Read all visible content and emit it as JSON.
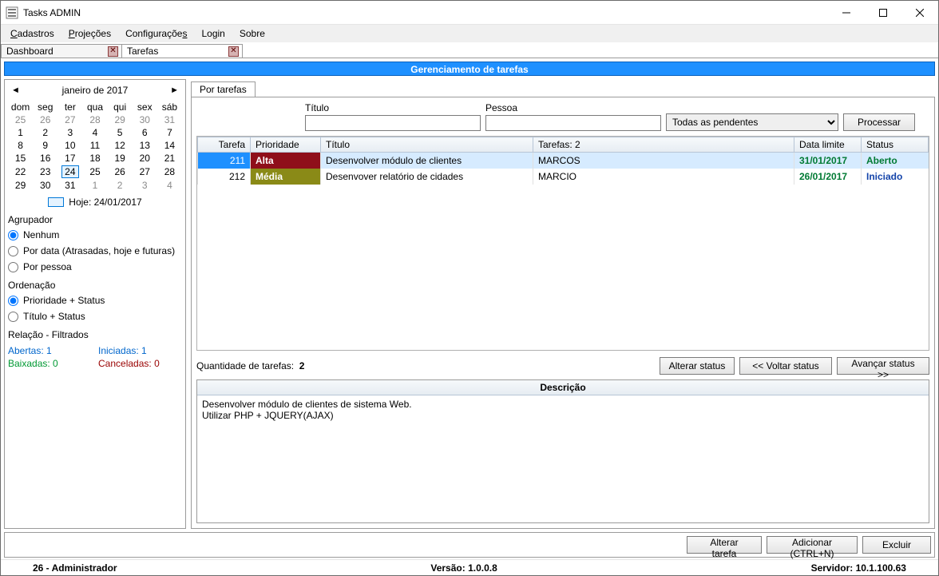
{
  "window": {
    "title": "Tasks ADMIN"
  },
  "menu": {
    "cadastros": "Cadastros",
    "projecoes": "Projeções",
    "configuracoes": "Configurações",
    "login": "Login",
    "sobre": "Sobre"
  },
  "tabs": {
    "dashboard": "Dashboard",
    "tarefas": "Tarefas"
  },
  "banner": "Gerenciamento de tarefas",
  "calendar": {
    "month": "janeiro de 2017",
    "dow": [
      "dom",
      "seg",
      "ter",
      "qua",
      "qui",
      "sex",
      "sáb"
    ],
    "weeks": [
      [
        {
          "d": "25",
          "g": true
        },
        {
          "d": "26",
          "g": true
        },
        {
          "d": "27",
          "g": true
        },
        {
          "d": "28",
          "g": true
        },
        {
          "d": "29",
          "g": true
        },
        {
          "d": "30",
          "g": true
        },
        {
          "d": "31",
          "g": true
        }
      ],
      [
        {
          "d": "1"
        },
        {
          "d": "2"
        },
        {
          "d": "3"
        },
        {
          "d": "4"
        },
        {
          "d": "5"
        },
        {
          "d": "6"
        },
        {
          "d": "7"
        }
      ],
      [
        {
          "d": "8"
        },
        {
          "d": "9"
        },
        {
          "d": "10"
        },
        {
          "d": "11"
        },
        {
          "d": "12"
        },
        {
          "d": "13"
        },
        {
          "d": "14"
        }
      ],
      [
        {
          "d": "15"
        },
        {
          "d": "16"
        },
        {
          "d": "17"
        },
        {
          "d": "18"
        },
        {
          "d": "19"
        },
        {
          "d": "20"
        },
        {
          "d": "21"
        }
      ],
      [
        {
          "d": "22"
        },
        {
          "d": "23"
        },
        {
          "d": "24",
          "t": true
        },
        {
          "d": "25"
        },
        {
          "d": "26"
        },
        {
          "d": "27"
        },
        {
          "d": "28"
        }
      ],
      [
        {
          "d": "29"
        },
        {
          "d": "30"
        },
        {
          "d": "31"
        },
        {
          "d": "1",
          "g": true
        },
        {
          "d": "2",
          "g": true
        },
        {
          "d": "3",
          "g": true
        },
        {
          "d": "4",
          "g": true
        }
      ]
    ],
    "today": "Hoje: 24/01/2017"
  },
  "agrupador": {
    "title": "Agrupador",
    "opts": {
      "nenhum": "Nenhum",
      "pordata": "Por data (Atrasadas, hoje e futuras)",
      "porpessoa": "Por pessoa"
    }
  },
  "ordenacao": {
    "title": "Ordenação",
    "opts": {
      "prio": "Prioridade + Status",
      "titulo": "Título + Status"
    }
  },
  "relacao": {
    "title": "Relação - Filtrados",
    "abertas_label": "Abertas:",
    "abertas_val": "1",
    "iniciadas_label": "Iniciadas:",
    "iniciadas_val": "1",
    "baixadas_label": "Baixadas:",
    "baixadas_val": "0",
    "canceladas_label": "Canceladas:",
    "canceladas_val": "0"
  },
  "subtab": "Por tarefas",
  "filters": {
    "titulo_label": "Título",
    "pessoa_label": "Pessoa",
    "status_select": "Todas as pendentes",
    "processar": "Processar"
  },
  "grid": {
    "headers": {
      "tarefa": "Tarefa",
      "prioridade": "Prioridade",
      "titulo": "Título",
      "tarefas": "Tarefas: 2",
      "datalimite": "Data limite",
      "status": "Status"
    },
    "rows": [
      {
        "id": "211",
        "prio": "Alta",
        "prio_cls": "alta",
        "titulo": "Desenvolver módulo de clientes",
        "pessoa": "MARCOS",
        "data": "31/01/2017",
        "status": "Aberto",
        "status_cls": "status-aberto",
        "selected": true
      },
      {
        "id": "212",
        "prio": "Média",
        "prio_cls": "media",
        "titulo": "Desenvover relatório de cidades",
        "pessoa": "MARCIO",
        "data": "26/01/2017",
        "status": "Iniciado",
        "status_cls": "status-iniciado",
        "selected": false
      }
    ]
  },
  "status_line": {
    "qty_label": "Quantidade de tarefas:",
    "qty_val": "2",
    "alterar": "Alterar status",
    "voltar": "<< Voltar status",
    "avancar": "Avançar status >>"
  },
  "descricao": {
    "header": "Descrição",
    "body": "Desenvolver módulo de clientes de sistema Web.\nUtilizar PHP + JQUERY(AJAX)"
  },
  "bottom": {
    "alterar": "Alterar tarefa",
    "adicionar": "Adicionar (CTRL+N)",
    "excluir": "Excluir"
  },
  "statusbar": {
    "user": "26 - Administrador",
    "versao": "Versão: 1.0.0.8",
    "servidor": "Servidor: 10.1.100.63"
  }
}
